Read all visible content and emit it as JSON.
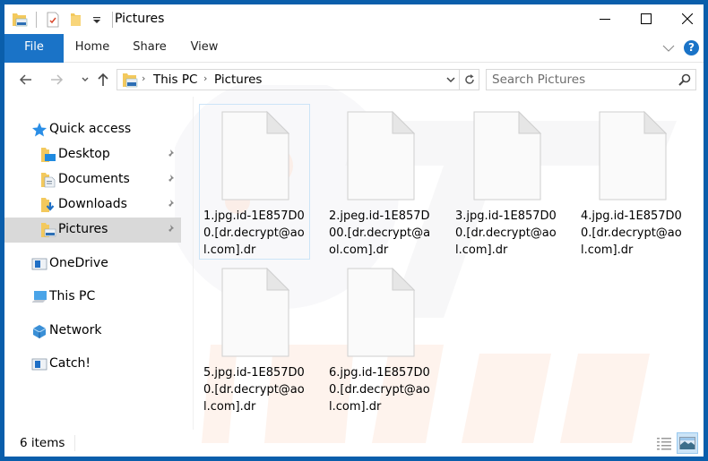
{
  "window": {
    "title": "Pictures",
    "border_color": "#0a5eab",
    "accent_color": "#1a73c7"
  },
  "quick_access_toolbar": {
    "icons": [
      "folder-pictures-icon",
      "properties-icon",
      "new-folder-icon",
      "customize-dropdown-icon"
    ]
  },
  "window_controls": {
    "minimize": "minimize-icon",
    "maximize": "maximize-icon",
    "close": "close-icon"
  },
  "ribbon": {
    "tabs": [
      {
        "label": "File",
        "active": true
      },
      {
        "label": "Home"
      },
      {
        "label": "Share"
      },
      {
        "label": "View"
      }
    ],
    "help_label": "?"
  },
  "navigation": {
    "back": "back-arrow-icon",
    "forward": "forward-arrow-icon",
    "recent": "recent-locations-chevron-icon",
    "up": "up-arrow-icon"
  },
  "address_bar": {
    "breadcrumbs": [
      "This PC",
      "Pictures"
    ],
    "separator": "›"
  },
  "search": {
    "placeholder": "Search Pictures",
    "value": ""
  },
  "nav_pane": {
    "quick_access": {
      "label": "Quick access"
    },
    "pinned": [
      {
        "label": "Desktop",
        "icon": "desktop-folder-icon",
        "pinned": true
      },
      {
        "label": "Documents",
        "icon": "documents-folder-icon",
        "pinned": true
      },
      {
        "label": "Downloads",
        "icon": "downloads-folder-icon",
        "pinned": true
      },
      {
        "label": "Pictures",
        "icon": "pictures-folder-icon",
        "pinned": true,
        "selected": true
      }
    ],
    "locations": [
      {
        "label": "OneDrive",
        "icon": "onedrive-icon"
      },
      {
        "label": "This PC",
        "icon": "this-pc-icon"
      },
      {
        "label": "Network",
        "icon": "network-icon"
      },
      {
        "label": "Catch!",
        "icon": "catch-drive-icon"
      }
    ]
  },
  "files": [
    {
      "name": "1.jpg.id-1E857D00.[dr.decrypt@aol.com].dr",
      "lines": [
        "1.jpg.id-1E857D0",
        "0.[dr.decrypt@ao",
        "l.com].dr"
      ],
      "focused": true
    },
    {
      "name": "2.jpeg.id-1E857D00.[dr.decrypt@aol.com].dr",
      "lines": [
        "2.jpeg.id-1E857D",
        "00.[dr.decrypt@a",
        "ol.com].dr"
      ]
    },
    {
      "name": "3.jpg.id-1E857D00.[dr.decrypt@aol.com].dr",
      "lines": [
        "3.jpg.id-1E857D0",
        "0.[dr.decrypt@ao",
        "l.com].dr"
      ]
    },
    {
      "name": "4.jpg.id-1E857D00.[dr.decrypt@aol.com].dr",
      "lines": [
        "4.jpg.id-1E857D0",
        "0.[dr.decrypt@ao",
        "l.com].dr"
      ]
    },
    {
      "name": "5.jpg.id-1E857D00.[dr.decrypt@aol.com].dr",
      "lines": [
        "5.jpg.id-1E857D0",
        "0.[dr.decrypt@ao",
        "l.com].dr"
      ]
    },
    {
      "name": "6.jpg.id-1E857D00.[dr.decrypt@aol.com].dr",
      "lines": [
        "6.jpg.id-1E857D0",
        "0.[dr.decrypt@ao",
        "l.com].dr"
      ]
    }
  ],
  "status_bar": {
    "item_count": "6 items",
    "views": [
      {
        "name": "details-view",
        "active": false
      },
      {
        "name": "large-icons-view",
        "active": true
      }
    ]
  }
}
